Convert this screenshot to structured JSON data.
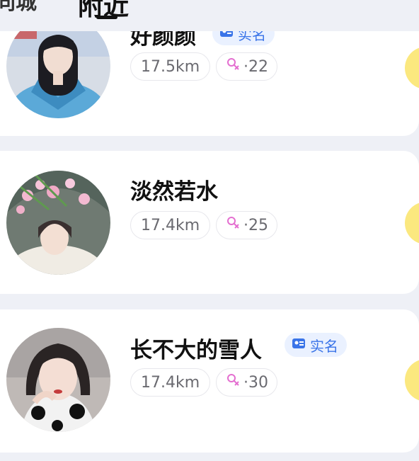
{
  "header": {
    "tab_left": "同城",
    "tab_active": "附近"
  },
  "users": [
    {
      "name": "好颜颜",
      "verified": true,
      "verified_label": "实名",
      "distance": "17.5km",
      "age_separator": "·",
      "age": "22"
    },
    {
      "name": "淡然若水",
      "verified": false,
      "distance": "17.4km",
      "age_separator": "·",
      "age": "25"
    },
    {
      "name": "长不大的雪人",
      "verified": true,
      "verified_label": "实名",
      "distance": "17.4km",
      "age_separator": "·",
      "age": "30"
    }
  ],
  "colors": {
    "accent_blue": "#3a74e8",
    "female_pink": "#e46fd0",
    "action_yellow": "#fbe87f",
    "page_bg": "#eef0f6"
  },
  "icons": {
    "gender": "female-icon",
    "verified": "id-card-icon"
  }
}
